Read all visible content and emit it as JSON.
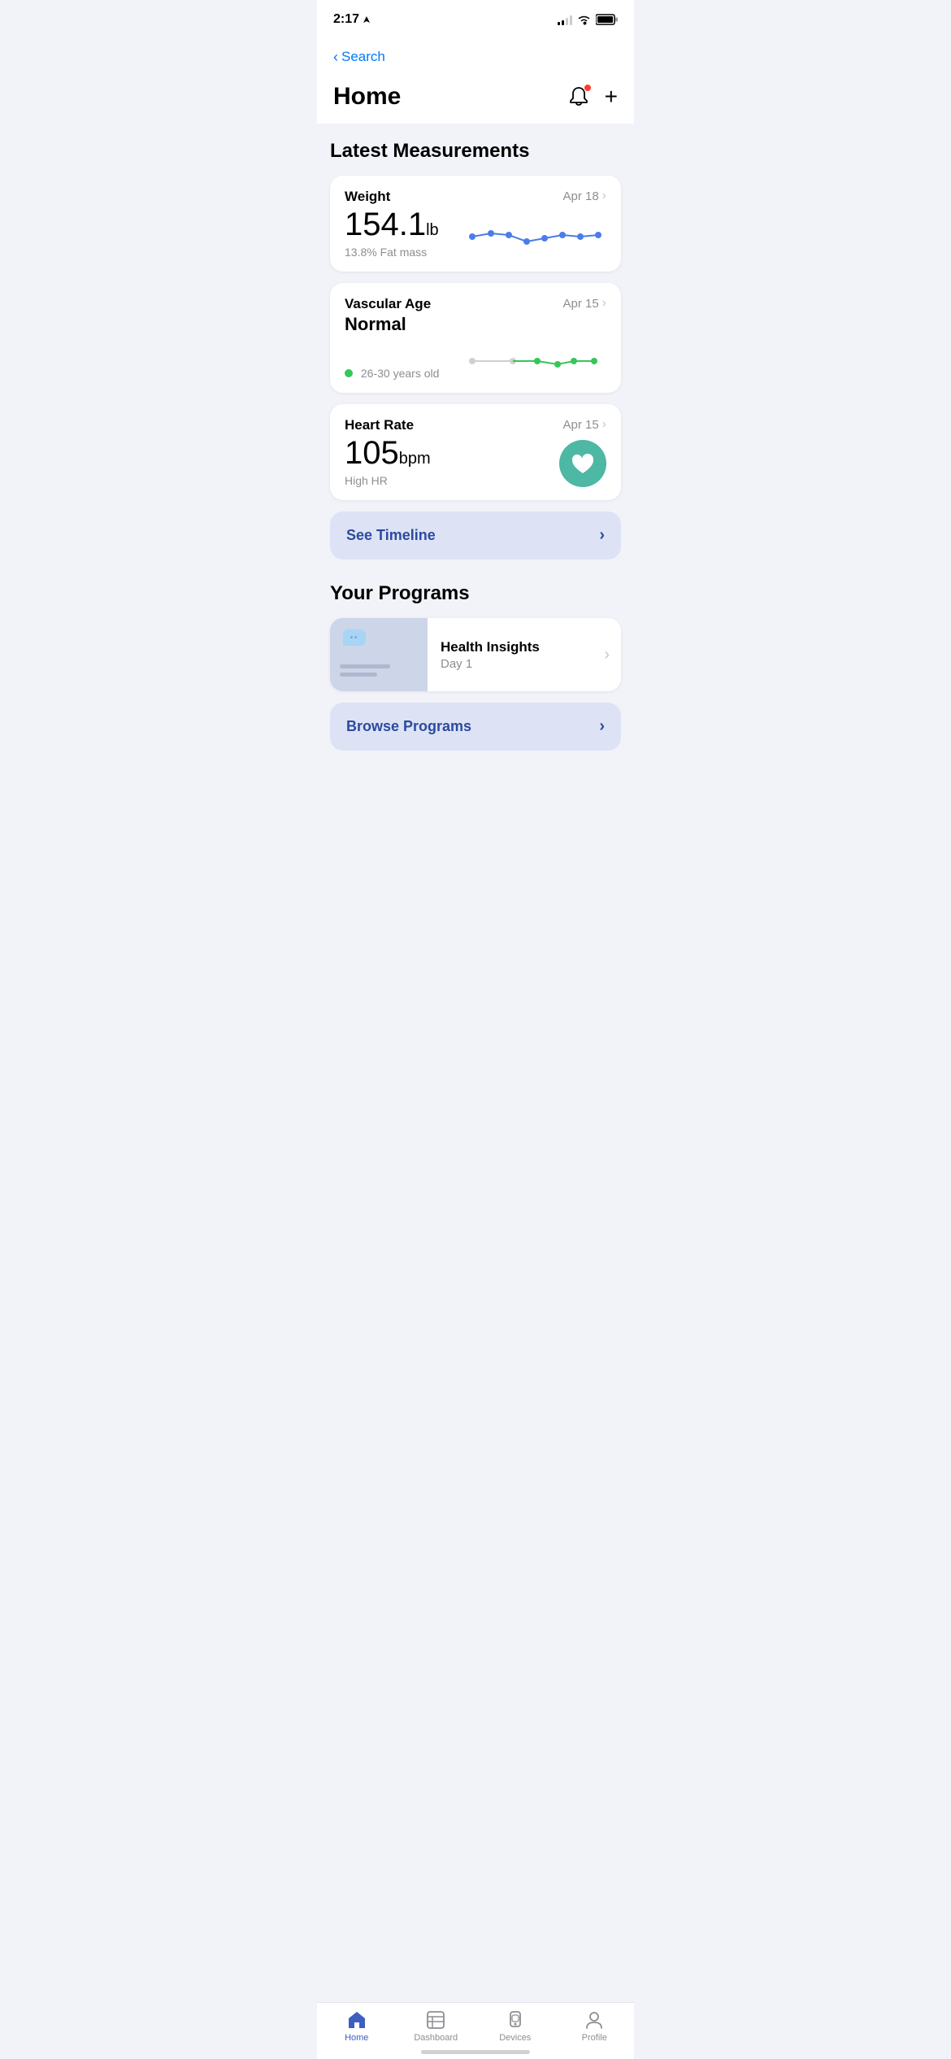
{
  "statusBar": {
    "time": "2:17",
    "back": "Search"
  },
  "header": {
    "title": "Home",
    "notificationDot": true
  },
  "sections": {
    "measurements": {
      "title": "Latest Measurements",
      "cards": [
        {
          "name": "Weight",
          "date": "Apr 18",
          "value": "154.1",
          "unit": "lb",
          "sub": "13.8% Fat mass",
          "type": "weight"
        },
        {
          "name": "Vascular Age",
          "status": "Normal",
          "date": "Apr 15",
          "sub": "26-30 years old",
          "type": "vascular"
        },
        {
          "name": "Heart Rate",
          "date": "Apr 15",
          "value": "105",
          "unit": "bpm",
          "sub": "High HR",
          "type": "heartrate"
        }
      ],
      "timelineBtn": "See Timeline"
    },
    "programs": {
      "title": "Your Programs",
      "items": [
        {
          "name": "Health Insights",
          "sub": "Day 1"
        }
      ],
      "browseBtn": "Browse Programs"
    }
  },
  "tabBar": {
    "items": [
      {
        "label": "Home",
        "active": true,
        "icon": "home"
      },
      {
        "label": "Dashboard",
        "active": false,
        "icon": "dashboard"
      },
      {
        "label": "Devices",
        "active": false,
        "icon": "devices"
      },
      {
        "label": "Profile",
        "active": false,
        "icon": "profile"
      }
    ]
  }
}
